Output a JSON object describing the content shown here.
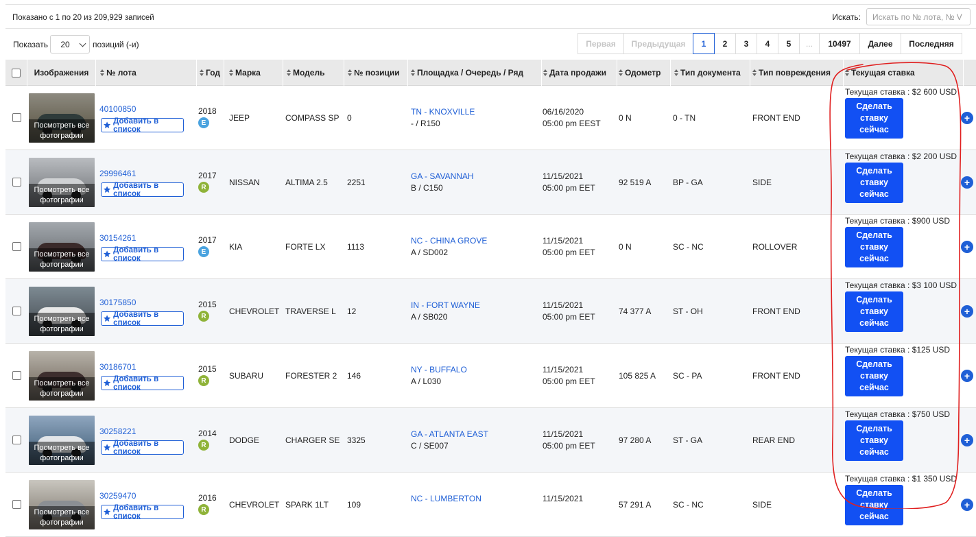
{
  "header": {
    "info": "Показано с 1 по 20 из 209,929 записей",
    "search_label": "Искать:",
    "search_placeholder": "Искать по № лота, № V",
    "show_label": "Показать",
    "per_page": "20",
    "per_page_suffix": "позиций (-и)"
  },
  "pagination": [
    {
      "label": "Первая",
      "state": "disabled",
      "w": 68
    },
    {
      "label": "Предыдущая",
      "state": "disabled",
      "w": 102
    },
    {
      "label": "1",
      "state": "active",
      "w": 32
    },
    {
      "label": "2",
      "state": "",
      "w": 32
    },
    {
      "label": "3",
      "state": "",
      "w": 32
    },
    {
      "label": "4",
      "state": "",
      "w": 32
    },
    {
      "label": "5",
      "state": "",
      "w": 32
    },
    {
      "label": "...",
      "state": "ell",
      "w": 30
    },
    {
      "label": "10497",
      "state": "",
      "w": 60
    },
    {
      "label": "Далее",
      "state": "",
      "w": 61
    },
    {
      "label": "Последняя",
      "state": "",
      "w": 90
    }
  ],
  "columns": {
    "images": "Изображения",
    "lot": "№ лота",
    "year": "Год",
    "make": "Марка",
    "model": "Модель",
    "item": "№ позиции",
    "location": "Площадка / Очередь / Ряд",
    "sale_date": "Дата продажи",
    "odometer": "Одометр",
    "doc_type": "Тип документа",
    "damage": "Тип повреждения",
    "current_bid": "Текущая ставка"
  },
  "labels": {
    "view_photos_1": "Посмотреть все",
    "view_photos_2": "фотографии",
    "add_to_list": "Добавить в список",
    "bid_line1": "Сделать",
    "bid_line2": "ставку",
    "bid_line3": "сейчас"
  },
  "rows": [
    {
      "lot": "40100850",
      "year": "2018",
      "badge": "E",
      "make": "JEEP",
      "model": "COMPASS SP",
      "item": "0",
      "location": "TN - KNOXVILLE",
      "lane": "- / R150",
      "date": "06/16/2020",
      "time": "05:00 pm EEST",
      "odometer": "0 N",
      "doc": "0 - TN",
      "damage": "FRONT END",
      "bid": "Текущая ставка : $2 600 USD"
    },
    {
      "lot": "29996461",
      "year": "2017",
      "badge": "R",
      "make": "NISSAN",
      "model": "ALTIMA 2.5",
      "item": "2251",
      "location": "GA - SAVANNAH",
      "lane": "B / C150",
      "date": "11/15/2021",
      "time": "05:00 pm EET",
      "odometer": "92 519 A",
      "doc": "BP - GA",
      "damage": "SIDE",
      "bid": "Текущая ставка : $2 200 USD"
    },
    {
      "lot": "30154261",
      "year": "2017",
      "badge": "E",
      "make": "KIA",
      "model": "FORTE LX",
      "item": "1113",
      "location": "NC - CHINA GROVE",
      "lane": "A / SD002",
      "date": "11/15/2021",
      "time": "05:00 pm EET",
      "odometer": "0 N",
      "doc": "SC - NC",
      "damage": "ROLLOVER",
      "bid": "Текущая ставка : $900 USD"
    },
    {
      "lot": "30175850",
      "year": "2015",
      "badge": "R",
      "make": "CHEVROLET",
      "model": "TRAVERSE L",
      "item": "12",
      "location": "IN - FORT WAYNE",
      "lane": "A / SB020",
      "date": "11/15/2021",
      "time": "05:00 pm EET",
      "odometer": "74 377 A",
      "doc": "ST - OH",
      "damage": "FRONT END",
      "bid": "Текущая ставка : $3 100 USD"
    },
    {
      "lot": "30186701",
      "year": "2015",
      "badge": "R",
      "make": "SUBARU",
      "model": "FORESTER 2",
      "item": "146",
      "location": "NY - BUFFALO",
      "lane": "A / L030",
      "date": "11/15/2021",
      "time": "05:00 pm EET",
      "odometer": "105 825 A",
      "doc": "SC - PA",
      "damage": "FRONT END",
      "bid": "Текущая ставка : $125 USD"
    },
    {
      "lot": "30258221",
      "year": "2014",
      "badge": "R",
      "make": "DODGE",
      "model": "CHARGER SE",
      "item": "3325",
      "location": "GA - ATLANTA EAST",
      "lane": "C / SE007",
      "date": "11/15/2021",
      "time": "05:00 pm EET",
      "odometer": "97 280 A",
      "doc": "ST - GA",
      "damage": "REAR END",
      "bid": "Текущая ставка : $750 USD"
    },
    {
      "lot": "30259470",
      "year": "2016",
      "badge": "R",
      "make": "CHEVROLET",
      "model": "SPARK 1LT",
      "item": "109",
      "location": "NC - LUMBERTON",
      "lane": "",
      "date": "11/15/2021",
      "time": "",
      "odometer": "57 291 A",
      "doc": "SC - NC",
      "damage": "SIDE",
      "bid": "Текущая ставка : $1 350 USD"
    }
  ],
  "colors": {
    "accent": "#1f5fd6",
    "bid_button": "#1250f3",
    "badge_e": "#4aa3df",
    "badge_r": "#8fb339",
    "annotation": "#e02020"
  }
}
